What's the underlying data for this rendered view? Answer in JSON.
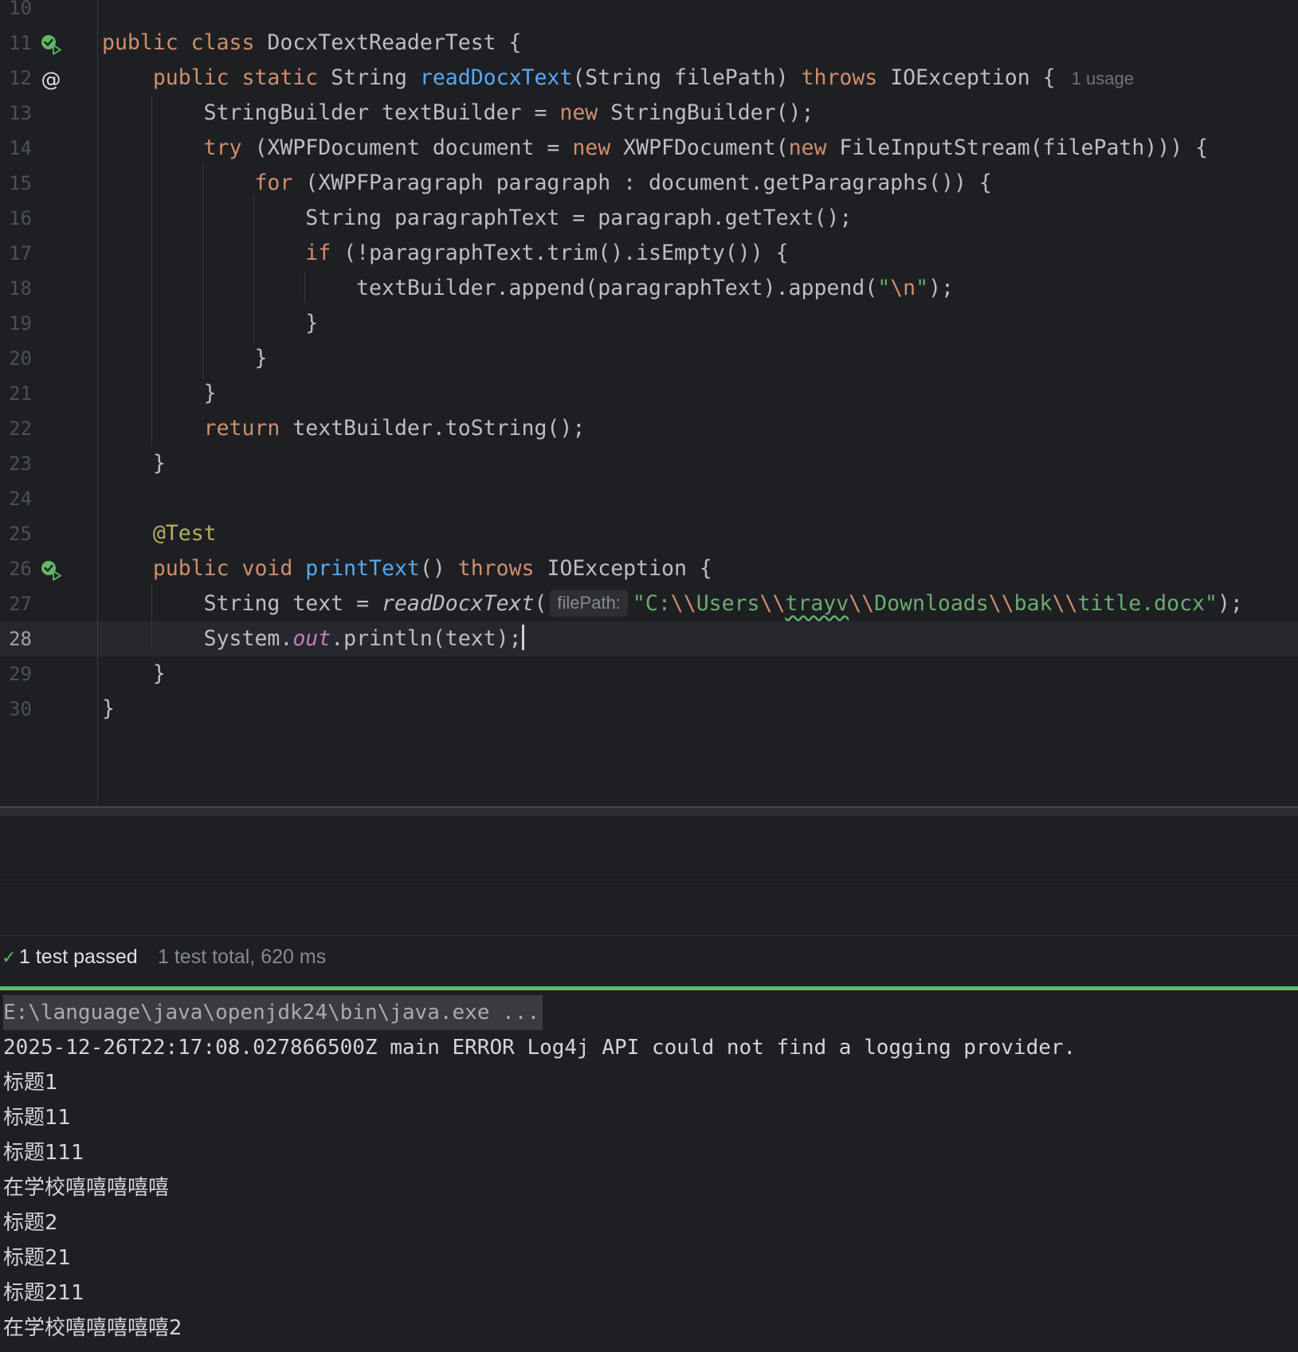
{
  "editor": {
    "current_line": 28,
    "lines": [
      {
        "num": "10",
        "tokens": []
      },
      {
        "num": "11",
        "icon": "run-test-icon",
        "tokens": [
          {
            "t": "public class ",
            "c": "kw"
          },
          {
            "t": "DocxTextReaderTest {"
          }
        ]
      },
      {
        "num": "12",
        "icon": "implemented-icon",
        "hint": "1 usage",
        "tokens": [
          {
            "t": "    "
          },
          {
            "t": "public static ",
            "c": "kw"
          },
          {
            "t": "String "
          },
          {
            "t": "readDocxText",
            "c": "fn"
          },
          {
            "t": "(String filePath) "
          },
          {
            "t": "throws ",
            "c": "kw"
          },
          {
            "t": "IOException {"
          }
        ]
      },
      {
        "num": "13",
        "tokens": [
          {
            "t": "        StringBuilder textBuilder = "
          },
          {
            "t": "new ",
            "c": "kw"
          },
          {
            "t": "StringBuilder();"
          }
        ]
      },
      {
        "num": "14",
        "tokens": [
          {
            "t": "        "
          },
          {
            "t": "try ",
            "c": "kw"
          },
          {
            "t": "(XWPFDocument document = "
          },
          {
            "t": "new ",
            "c": "kw"
          },
          {
            "t": "XWPFDocument("
          },
          {
            "t": "new ",
            "c": "kw"
          },
          {
            "t": "FileInputStream(filePath))) {"
          }
        ]
      },
      {
        "num": "15",
        "tokens": [
          {
            "t": "            "
          },
          {
            "t": "for ",
            "c": "kw"
          },
          {
            "t": "(XWPFParagraph paragraph : document.getParagraphs()) {"
          }
        ]
      },
      {
        "num": "16",
        "tokens": [
          {
            "t": "                String paragraphText = paragraph.getText();"
          }
        ]
      },
      {
        "num": "17",
        "tokens": [
          {
            "t": "                "
          },
          {
            "t": "if ",
            "c": "kw"
          },
          {
            "t": "(!paragraphText.trim().isEmpty()) {"
          }
        ]
      },
      {
        "num": "18",
        "tokens": [
          {
            "t": "                    textBuilder.append(paragraphText).append("
          },
          {
            "t": "\"",
            "c": "str"
          },
          {
            "t": "\\n",
            "c": "esc"
          },
          {
            "t": "\"",
            "c": "str"
          },
          {
            "t": ");"
          }
        ]
      },
      {
        "num": "19",
        "tokens": [
          {
            "t": "                }"
          }
        ]
      },
      {
        "num": "20",
        "tokens": [
          {
            "t": "            }"
          }
        ]
      },
      {
        "num": "21",
        "tokens": [
          {
            "t": "        }"
          }
        ]
      },
      {
        "num": "22",
        "tokens": [
          {
            "t": "        "
          },
          {
            "t": "return ",
            "c": "kw"
          },
          {
            "t": "textBuilder.toString();"
          }
        ]
      },
      {
        "num": "23",
        "tokens": [
          {
            "t": "    }"
          }
        ]
      },
      {
        "num": "24",
        "tokens": []
      },
      {
        "num": "25",
        "tokens": [
          {
            "t": "    "
          },
          {
            "t": "@Test",
            "c": "ann"
          }
        ]
      },
      {
        "num": "26",
        "icon": "run-test-icon",
        "tokens": [
          {
            "t": "    "
          },
          {
            "t": "public void ",
            "c": "kw"
          },
          {
            "t": "printText",
            "c": "fn"
          },
          {
            "t": "() "
          },
          {
            "t": "throws ",
            "c": "kw"
          },
          {
            "t": "IOException {"
          }
        ]
      },
      {
        "num": "27",
        "tokens": [
          {
            "t": "        String text = "
          },
          {
            "t": "readDocxText",
            "c": "ital"
          },
          {
            "t": "("
          },
          {
            "t": "filePath:",
            "c": "inlay"
          },
          {
            "t": "\"C:",
            "c": "str"
          },
          {
            "t": "\\\\",
            "c": "esc"
          },
          {
            "t": "Users",
            "c": "str"
          },
          {
            "t": "\\\\",
            "c": "esc"
          },
          {
            "t": "trayv",
            "c": "str squiggle"
          },
          {
            "t": "\\\\",
            "c": "esc"
          },
          {
            "t": "Downloads",
            "c": "str"
          },
          {
            "t": "\\\\",
            "c": "esc"
          },
          {
            "t": "bak",
            "c": "str"
          },
          {
            "t": "\\\\",
            "c": "esc"
          },
          {
            "t": "title.docx\"",
            "c": "str"
          },
          {
            "t": ");"
          }
        ]
      },
      {
        "num": "28",
        "caret": true,
        "tokens": [
          {
            "t": "        System."
          },
          {
            "t": "out",
            "c": "static-field"
          },
          {
            "t": ".println(text);"
          }
        ]
      },
      {
        "num": "29",
        "tokens": [
          {
            "t": "    }"
          }
        ]
      },
      {
        "num": "30",
        "tokens": [
          {
            "t": "}"
          }
        ]
      }
    ]
  },
  "test_run": {
    "status": "1 test passed",
    "summary": "1 test total, 620 ms",
    "progress": 1.0,
    "status_color": "#5fb865"
  },
  "console": {
    "command": "E:\\language\\java\\openjdk24\\bin\\java.exe ...",
    "lines": [
      "2025-12-26T22:17:08.027866500Z main ERROR Log4j API could not find a logging provider.",
      "标题1",
      "标题11",
      "标题111",
      "在学校嘻嘻嘻嘻嘻",
      "标题2",
      "标题21",
      "标题211",
      "在学校嘻嘻嘻嘻嘻2"
    ]
  }
}
